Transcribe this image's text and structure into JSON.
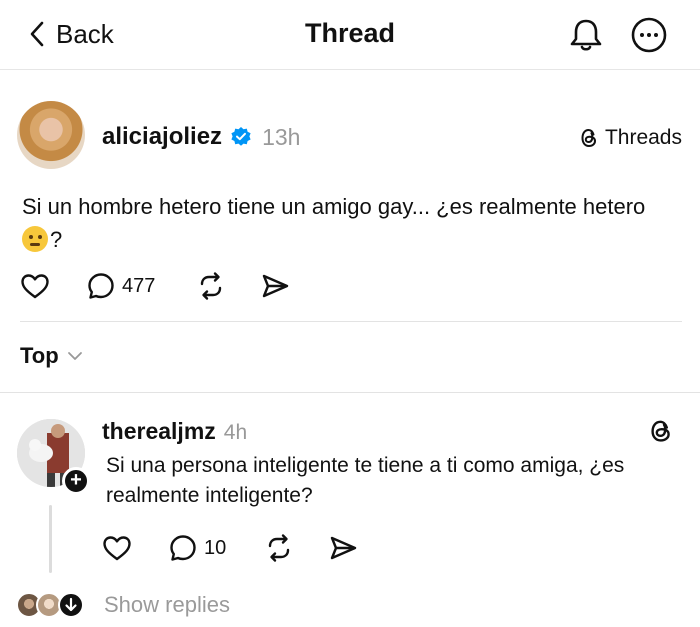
{
  "header": {
    "back_label": "Back",
    "title": "Thread"
  },
  "post": {
    "author": "aliciajoliez",
    "verified": true,
    "time": "13h",
    "source_label": "Threads",
    "text": "Si un hombre hetero tiene un amigo gay... ¿es realmente hetero",
    "text_suffix": "?",
    "reply_count": "477"
  },
  "sort": {
    "label": "Top"
  },
  "reply": {
    "author": "therealjmz",
    "time": "4h",
    "text": "Si una persona inteligente te tiene a ti como amiga, ¿es realmente inteligente?",
    "reply_count": "10",
    "follow_symbol": "+",
    "show_replies_label": "Show replies"
  },
  "colors": {
    "verified_blue": "#0095f6",
    "muted_text": "#999999",
    "divider": "#e3e3e3"
  },
  "icons": {
    "back": "chevron-left-icon",
    "notifications": "bell-icon",
    "more": "more-horizontal-icon",
    "verified": "verified-badge-icon",
    "threads": "threads-logo-icon",
    "like": "heart-icon",
    "comment": "comment-icon",
    "repost": "repost-icon",
    "share": "send-icon",
    "sort": "chevron-down-icon",
    "emoji": "thinking-face-emoji"
  }
}
